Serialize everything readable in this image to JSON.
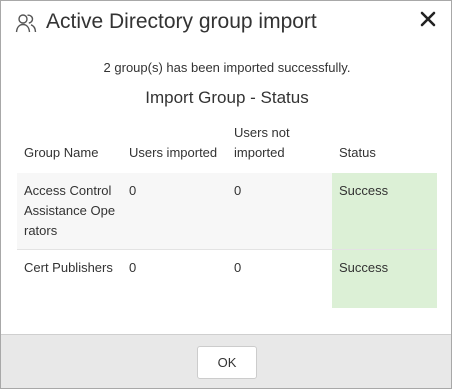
{
  "dialog": {
    "title": "Active Directory group import",
    "icon": "users-icon",
    "close_icon": "close-icon"
  },
  "message": "2 group(s) has been imported successfully.",
  "subtitle": "Import Group - Status",
  "table": {
    "columns": [
      "Group Name",
      "Users imported",
      "Users not imported",
      "Status"
    ],
    "rows": [
      {
        "group_name": "Access Control Assistance Operators",
        "users_imported": "0",
        "users_not_imported": "0",
        "status": "Success"
      },
      {
        "group_name": "Cert Publishers",
        "users_imported": "0",
        "users_not_imported": "0",
        "status": "Success"
      }
    ]
  },
  "footer": {
    "ok_label": "OK"
  },
  "colors": {
    "success_bg": "#dcf0d6",
    "footer_bg": "#e8e8e8"
  }
}
